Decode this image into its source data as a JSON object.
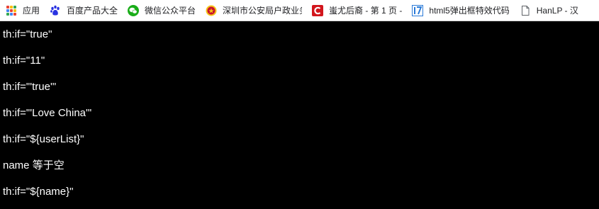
{
  "bookmarks": {
    "apps_label": "应用",
    "items": [
      {
        "label": "百度产品大全",
        "icon": "baidu-paw-icon"
      },
      {
        "label": "微信公众平台",
        "icon": "wechat-icon"
      },
      {
        "label": "深圳市公安局户政业务",
        "icon": "police-badge-icon"
      },
      {
        "label": "蚩尤后裔 - 第 1 页 -",
        "icon": "cnblogs-c-icon"
      },
      {
        "label": "html5弹出框特效代码",
        "icon": "site-17-icon"
      },
      {
        "label": "HanLP - 汉",
        "icon": "document-icon"
      }
    ]
  },
  "output_lines": [
    "th:if=\"true\"",
    "th:if=\"11\"",
    "th:if=\"'true'\"",
    "th:if=\"'Love China'\"",
    "th:if=\"${userList}\"",
    "name 等于空",
    "th:if=\"${name}\""
  ],
  "colors": {
    "page_background": "#000000",
    "text": "#ffffff",
    "bookmarks_background": "#ffffff"
  }
}
